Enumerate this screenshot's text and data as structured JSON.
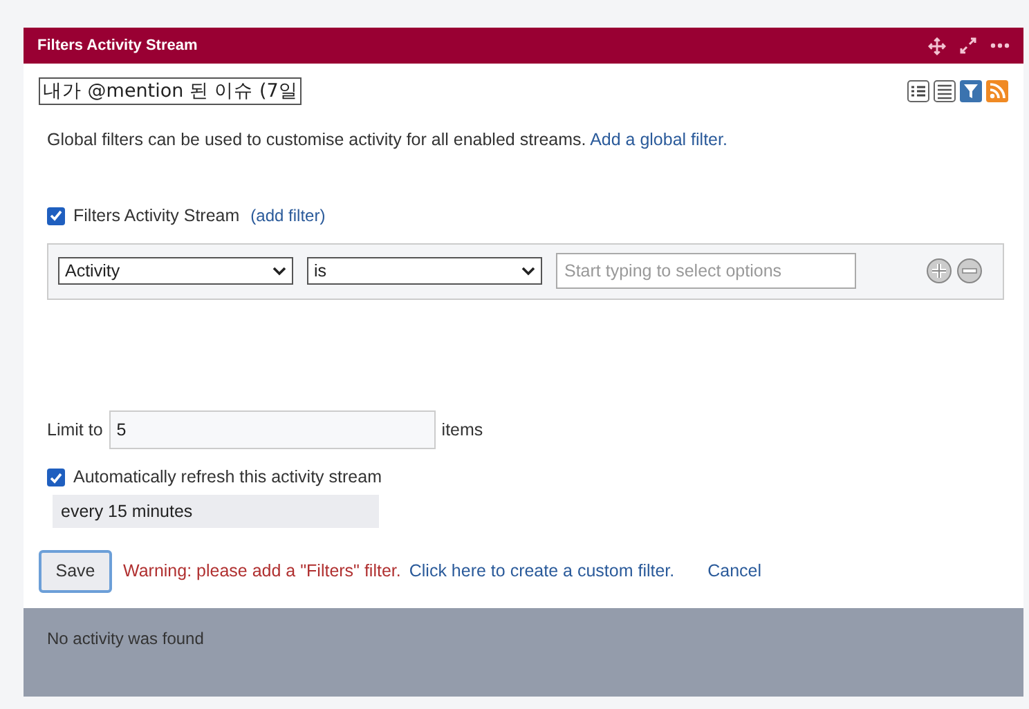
{
  "header": {
    "title": "Filters Activity Stream"
  },
  "title_field": {
    "value": "내가 @mention 된 이슈 (7일"
  },
  "intro": {
    "text": "Global filters can be used to customise activity for all enabled streams.",
    "link": "Add a global filter."
  },
  "stream": {
    "label": "Filters Activity Stream",
    "checked": true,
    "link": "(add filter)"
  },
  "filter_row": {
    "field": "Activity",
    "operator": "is",
    "placeholder": "Start typing to select options"
  },
  "limit": {
    "label": "Limit to",
    "value": "5",
    "suffix": "items"
  },
  "refresh": {
    "label": "Automatically refresh this activity stream",
    "checked": true,
    "interval": "every 15 minutes"
  },
  "footer": {
    "save": "Save",
    "warning": "Warning: please add a \"Filters\" filter.",
    "custom_link": "Click here to create a custom filter.",
    "cancel": "Cancel"
  },
  "result": {
    "text": "No activity was found"
  }
}
